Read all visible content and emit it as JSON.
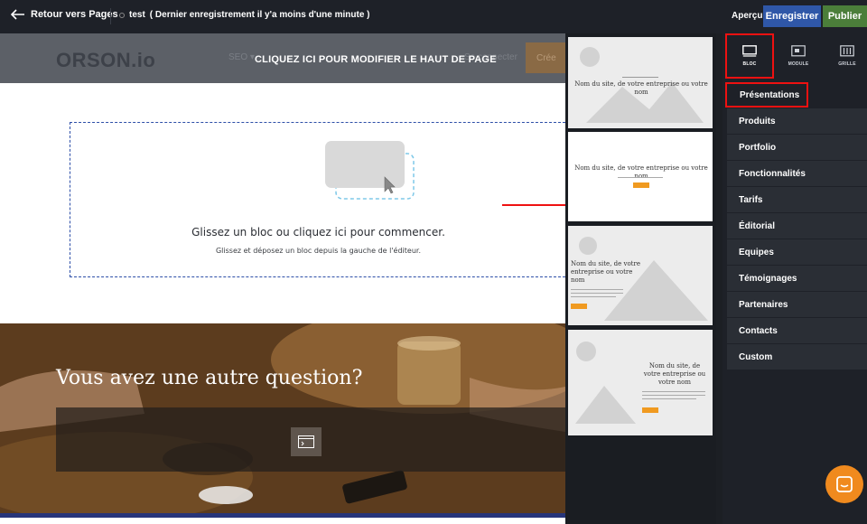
{
  "topbar": {
    "back_label": "Retour vers Pages",
    "page_name": "test",
    "save_status": "( Dernier enregistrement il y'a moins d'une minute )",
    "preview_label": "Aperçu",
    "save_label": "Enregistrer",
    "publish_label": "Publier"
  },
  "site": {
    "logo": "ORSON.io",
    "seo_label": "SEO ▾",
    "connect_label": "Se connecter",
    "create_label": "Crée",
    "header_overlay": "CLIQUEZ ICI POUR MODIFIER LE HAUT DE PAGE"
  },
  "dropzone": {
    "title": "Glissez un bloc ou cliquez ici pour commencer.",
    "subtitle": "Glissez et déposez un bloc depuis la gauche de l'éditeur."
  },
  "photo_section": {
    "title": "Vous avez une autre question?"
  },
  "thumbnails": [
    {
      "title": "Nom du site, de votre entreprise ou votre nom"
    },
    {
      "title": "Nom du site, de votre entreprise ou votre nom"
    },
    {
      "title": "Nom du site, de votre entreprise ou votre nom"
    },
    {
      "title": "Nom du site, de votre entreprise ou votre nom"
    }
  ],
  "sidebar": {
    "tabs": [
      {
        "label": "BLOC",
        "icon": "bloc-icon"
      },
      {
        "label": "MODULE",
        "icon": "module-icon"
      },
      {
        "label": "GRILLE",
        "icon": "grille-icon"
      }
    ],
    "categories": [
      {
        "label": "Présentations"
      },
      {
        "label": "Produits"
      },
      {
        "label": "Portfolio"
      },
      {
        "label": "Fonctionnalités"
      },
      {
        "label": "Tarifs"
      },
      {
        "label": "Éditorial"
      },
      {
        "label": "Equipes"
      },
      {
        "label": "Témoignages"
      },
      {
        "label": "Partenaires"
      },
      {
        "label": "Contacts"
      },
      {
        "label": "Custom"
      }
    ]
  },
  "colors": {
    "save": "#2f57a8",
    "publish": "#4b7e3a",
    "highlight": "#ee1111",
    "chat": "#f08a1e",
    "dropzone_border": "#2d4fa8"
  }
}
